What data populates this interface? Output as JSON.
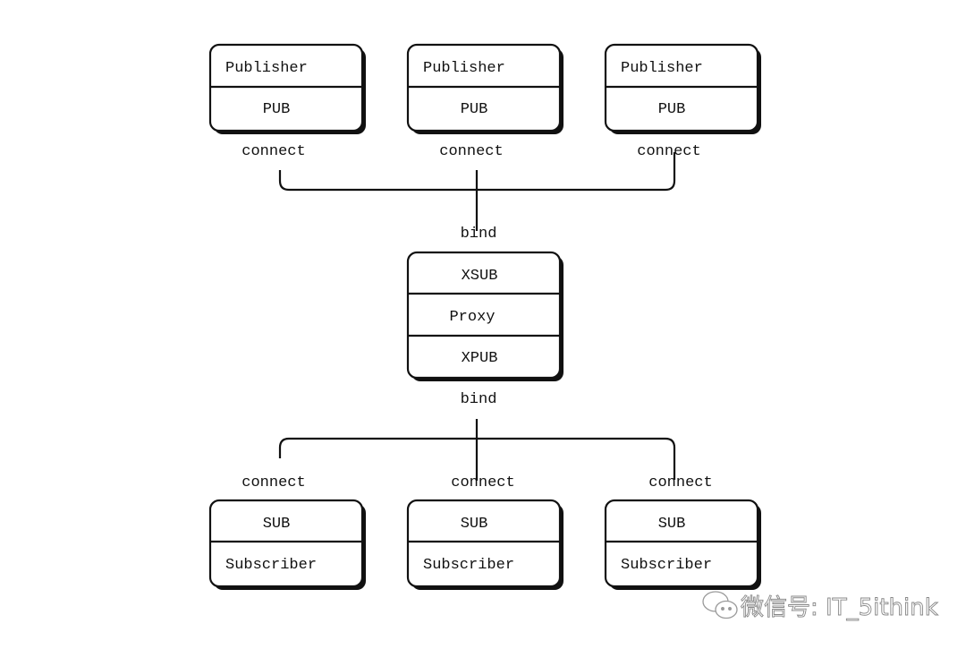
{
  "publishers": [
    {
      "name": "Publisher",
      "socket": "PUB",
      "link": "connect"
    },
    {
      "name": "Publisher",
      "socket": "PUB",
      "link": "connect"
    },
    {
      "name": "Publisher",
      "socket": "PUB",
      "link": "connect"
    }
  ],
  "proxy": {
    "top_bind": "bind",
    "frontend": "XSUB",
    "name": "Proxy",
    "backend": "XPUB",
    "bottom_bind": "bind"
  },
  "subscribers": [
    {
      "socket": "SUB",
      "name": "Subscriber",
      "link": "connect"
    },
    {
      "socket": "SUB",
      "name": "Subscriber",
      "link": "connect"
    },
    {
      "socket": "SUB",
      "name": "Subscriber",
      "link": "connect"
    }
  ],
  "watermark": {
    "text": "微信号: IT_5ithink",
    "icon": "wechat-icon"
  }
}
